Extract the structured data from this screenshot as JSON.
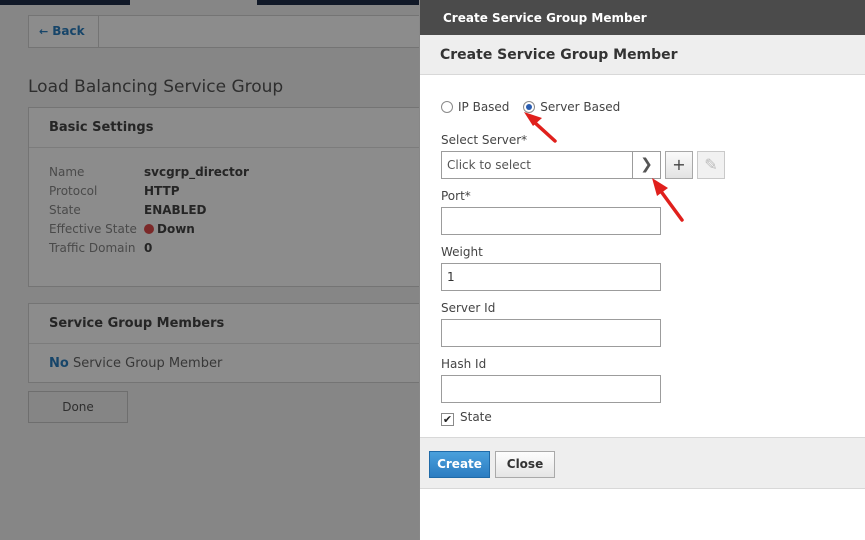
{
  "background": {
    "back_label": "Back",
    "page_title": "Load Balancing Service Group",
    "basic_settings": {
      "title": "Basic Settings",
      "rows": [
        {
          "key": "Name",
          "value": "svcgrp_director"
        },
        {
          "key": "Protocol",
          "value": "HTTP"
        },
        {
          "key": "State",
          "value": "ENABLED"
        },
        {
          "key": "Effective State",
          "value": "Down"
        },
        {
          "key": "Traffic Domain",
          "value": "0"
        }
      ]
    },
    "members": {
      "title": "Service Group Members",
      "no_prefix": "No",
      "no_text": "Service Group Member"
    },
    "done_label": "Done"
  },
  "dialog": {
    "topbar_title": "Create Service Group Member",
    "header_title": "Create Service Group Member",
    "radio": {
      "ip_label": "IP Based",
      "server_label": "Server Based",
      "selected": "Server Based"
    },
    "select_server": {
      "label": "Select Server*",
      "value": "Click to select"
    },
    "fields": {
      "port_label": "Port*",
      "port_value": "",
      "weight_label": "Weight",
      "weight_value": "1",
      "server_id_label": "Server Id",
      "server_id_value": "",
      "hash_id_label": "Hash Id",
      "hash_id_value": ""
    },
    "state_label": "State",
    "state_checked": true,
    "create_label": "Create",
    "close_label": "Close"
  },
  "colors": {
    "accent": "#2b7cc1",
    "annotation_arrow": "#e0201c",
    "status_down": "#e14a4a"
  },
  "icons": {
    "back": "left-arrow-icon",
    "select_arrow": "chevron-right-icon",
    "add": "plus-icon",
    "edit": "pencil-icon",
    "checkbox": "check-icon"
  }
}
